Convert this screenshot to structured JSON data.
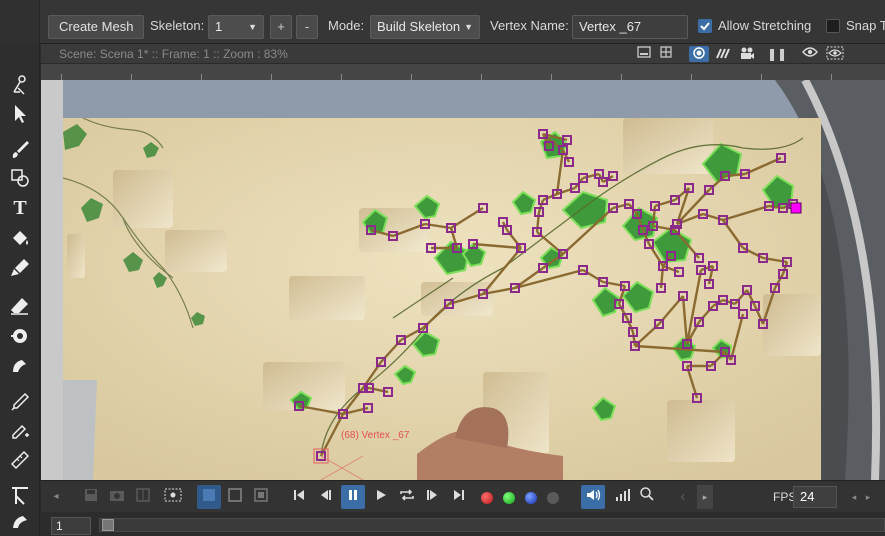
{
  "toolbar": {
    "create_mesh_label": "Create Mesh",
    "skeleton_label": "Skeleton:",
    "skeleton_value": "1",
    "add_label": "+",
    "remove_label": "-",
    "mode_label": "Mode:",
    "mode_value": "Build Skeleton",
    "vertex_name_label": "Vertex Name:",
    "vertex_name_value": "Vertex _67",
    "allow_stretching_label": "Allow Stretching",
    "allow_stretching_checked": true,
    "snap_label": "Snap T"
  },
  "view_header": {
    "info": "Scene: Scena 1*  ::  Frame: 1  ::  Zoom : 83%"
  },
  "canvas": {
    "vertex_annotation": "(68)  Vertex  _67"
  },
  "transport": {
    "fps_label": "FPS",
    "fps_value": "24"
  },
  "timeline": {
    "frame_value": "1"
  },
  "colors": {
    "accent": "#3b6ea6",
    "bone": "#8a6a30",
    "joint": "#8b2a8b",
    "selected_joint": "#ff00ff",
    "leaf": "#3e9a3a",
    "leaf_outline": "#7ee05a"
  }
}
